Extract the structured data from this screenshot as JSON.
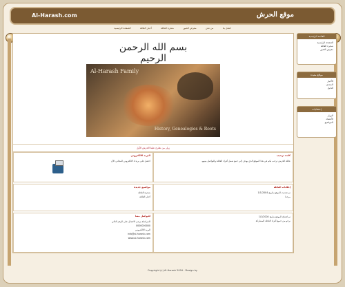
{
  "header": {
    "title_ar": "موقع الحرش",
    "domain": "Al-Harash.com"
  },
  "nav": {
    "items": [
      "الصفحة الرئيسية",
      "أخبار العائلة",
      "شجرة العائلة",
      "معرض الصور",
      "من نحن",
      "اتصل بنا"
    ]
  },
  "main": {
    "bismillah": "بسم الله الرحمن الرحيم",
    "banner": {
      "title": "Al-Harash Family",
      "subtitle": "History, Genealogies & Roots"
    },
    "linkbar": "زوار من نطرح علينا الحرش الأول",
    "cells": {
      "top_right_title": "كلمة ترحيب",
      "top_right_text": "عائلة الحرش ترحب بكم في هذا الموقع الذي يهدف إلى جمع شمل أفراد العائلة والتواصل بينهم.",
      "top_left_title": "البريد الالكتروني",
      "top_left_text": "احصل على بريدك الالكتروني المجاني الآن",
      "mid_right_title": "إعلانات العائلة",
      "mid_right_lines": [
        "تم تحديث الموقع بتاريخ 1/1/2004",
        "مرحبا"
      ],
      "mid_left_title": "مواضيع جديدة",
      "mid_left_lines": [
        "شجرة العائلة",
        "أخبار العائلة"
      ],
      "bottom_right_lines": [
        "تم افتتاح الموقع بتاريخ 1/1/2004",
        "نرجو من جميع أفراد العائلة المشاركة"
      ],
      "bottom_left_title": "للتواصل معنا",
      "bottom_left_lines": [
        "للمراسلة يرجى الاتصال على الرقم التالي",
        "0000000000",
        "البريد الالكتروني",
        "info@al-harash.com",
        "www.al-harash.com"
      ]
    }
  },
  "sidebar": {
    "box1": {
      "title": "القائمة الرئيسية",
      "items": [
        "الصفحة الرئيسية",
        "شجرة العائلة",
        "معرض الصور"
      ]
    },
    "box2": {
      "title": "مواقع مفيدة",
      "items": [
        "الأخبار",
        "المنتدى",
        "الدليل"
      ]
    },
    "box3": {
      "title": "إحصائيات",
      "items": [
        "الزوار",
        "الأعضاء",
        "المواضيع"
      ]
    }
  },
  "footer": {
    "text": "Copyright (c) Al-Harash 2004 - Design by"
  }
}
